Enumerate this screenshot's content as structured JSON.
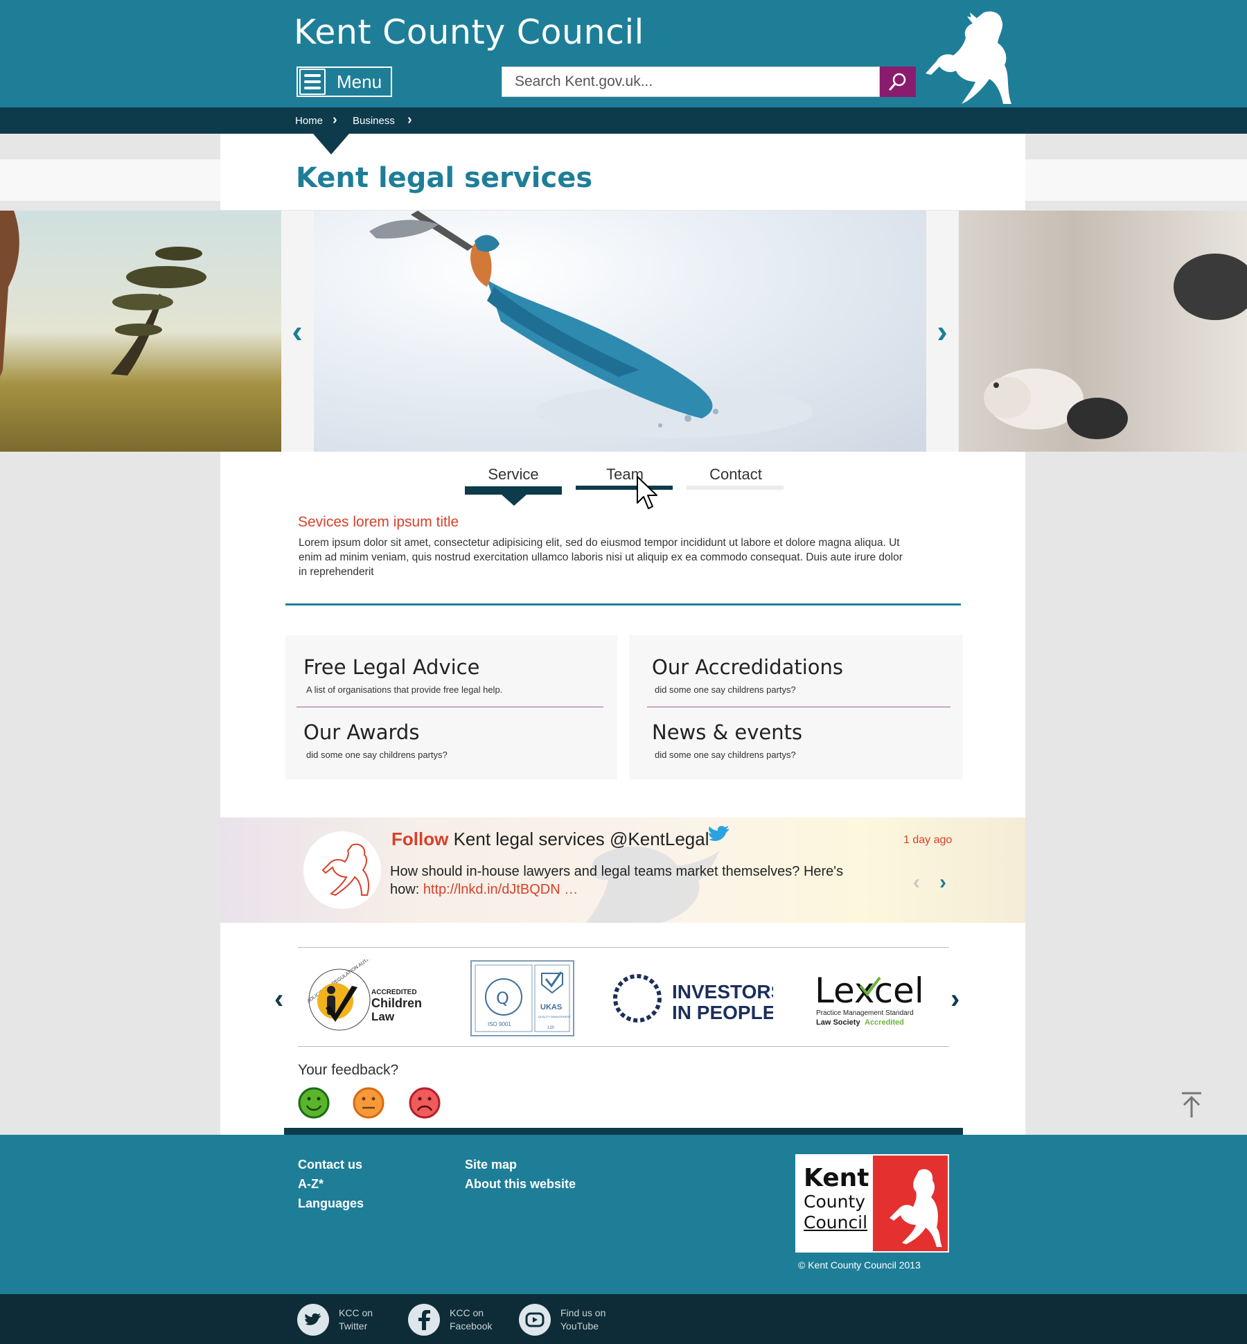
{
  "header": {
    "site_title": "Kent County Council",
    "menu_label": "Menu",
    "search_placeholder": "Search Kent.gov.uk..."
  },
  "breadcrumb": [
    "Home",
    "Business"
  ],
  "page_title": "Kent legal services",
  "tabs": [
    {
      "label": "Service",
      "active": true
    },
    {
      "label": "Team",
      "active": false
    },
    {
      "label": "Contact",
      "active": false
    }
  ],
  "service": {
    "title": "Sevices  lorem ipsum title",
    "body": "Lorem ipsum dolor sit amet, consectetur adipisicing elit, sed do eiusmod tempor incididunt ut labore et dolore magna aliqua. Ut enim ad minim veniam, quis nostrud exercitation ullamco laboris nisi ut aliquip ex ea commodo consequat. Duis aute irure dolor in reprehenderit"
  },
  "panels": {
    "left": [
      {
        "heading": "Free Legal Advice",
        "sub": "A list of organisations that provide free legal help."
      },
      {
        "heading": "Our Awards",
        "sub": "did some one say childrens partys?"
      }
    ],
    "right": [
      {
        "heading": "Our Accredidations",
        "sub": "did some one say childrens partys?"
      },
      {
        "heading": "News & events",
        "sub": "did some one say childrens partys?"
      }
    ]
  },
  "tweet": {
    "follow": "Follow",
    "account": "Kent legal services @KentLegal",
    "time": "1 day ago",
    "text": "How should in-house lawyers and legal teams market themselves? Here's how: ",
    "link": "http://lnkd.in/dJtBQDN",
    "ellipsis": "…"
  },
  "logos": {
    "children_law": {
      "line1": "ACCREDITED",
      "line2": "Children",
      "line3": "Law",
      "ring": "SOLICITORS REGULATION AUTHORITY"
    },
    "iso": {
      "left": "ISO 9001",
      "right": "UKAS",
      "right_sub": "QUALITY MANAGEMENT",
      "number": "120"
    },
    "iip": {
      "line1": "INVESTORS",
      "line2": "IN PEOPLE"
    },
    "lexcel": {
      "name": "Lexcel",
      "line1": "Practice Management Standard",
      "line2a": "Law Society",
      "line2b": "Accredited"
    }
  },
  "feedback": {
    "title": "Your feedback?"
  },
  "footer": {
    "col1": [
      "Contact us",
      "A-Z*",
      "Languages"
    ],
    "col2": [
      "Site map",
      "About this website"
    ],
    "badge": [
      "Kent",
      "County",
      "Council"
    ],
    "copyright": "© Kent County Council 2013"
  },
  "social": [
    {
      "line1": "KCC on",
      "line2": "Twitter"
    },
    {
      "line1": "KCC on",
      "line2": "Facebook"
    },
    {
      "line1": "Find us on",
      "line2": "YouTube"
    }
  ],
  "colors": {
    "brand_teal": "#1e7e98",
    "dark_navy": "#0e3b4c",
    "accent_red": "#d8402a",
    "search_purple": "#8a1c6e"
  }
}
